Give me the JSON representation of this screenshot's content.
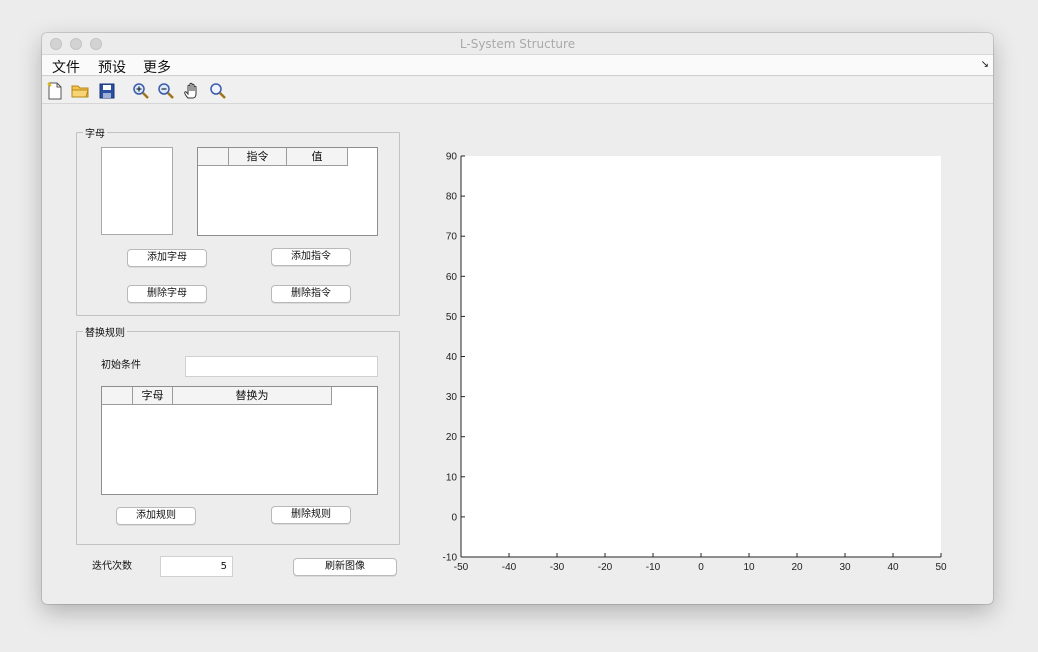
{
  "window": {
    "title": "L-System Structure"
  },
  "menubar": {
    "items": [
      "文件",
      "预设",
      "更多"
    ],
    "corner": "↘"
  },
  "toolbar": {
    "icons": [
      "new-file-icon",
      "open-folder-icon",
      "save-icon",
      "zoom-in-icon",
      "zoom-out-icon",
      "pan-hand-icon",
      "data-cursor-icon"
    ]
  },
  "letters_panel": {
    "title": "字母",
    "table_headers": [
      "",
      "指令",
      "值"
    ],
    "add_letter": "添加字母",
    "add_instruction": "添加指令",
    "delete_letter": "删除字母",
    "delete_instruction": "删除指令"
  },
  "rules_panel": {
    "title": "替换规则",
    "initial_label": "初始条件",
    "initial_value": "",
    "table_headers": [
      "",
      "字母",
      "替换为"
    ],
    "add_rule": "添加规则",
    "delete_rule": "删除规则"
  },
  "iterations": {
    "label": "迭代次数",
    "value": "5"
  },
  "refresh_button": "刷新图像",
  "chart_data": {
    "type": "line",
    "xlim": [
      -50,
      50
    ],
    "ylim": [
      -10,
      90
    ],
    "xticks": [
      -50,
      -40,
      -30,
      -20,
      -10,
      0,
      10,
      20,
      30,
      40,
      50
    ],
    "yticks": [
      -10,
      0,
      10,
      20,
      30,
      40,
      50,
      60,
      70,
      80,
      90
    ],
    "series": [],
    "grid": false
  }
}
